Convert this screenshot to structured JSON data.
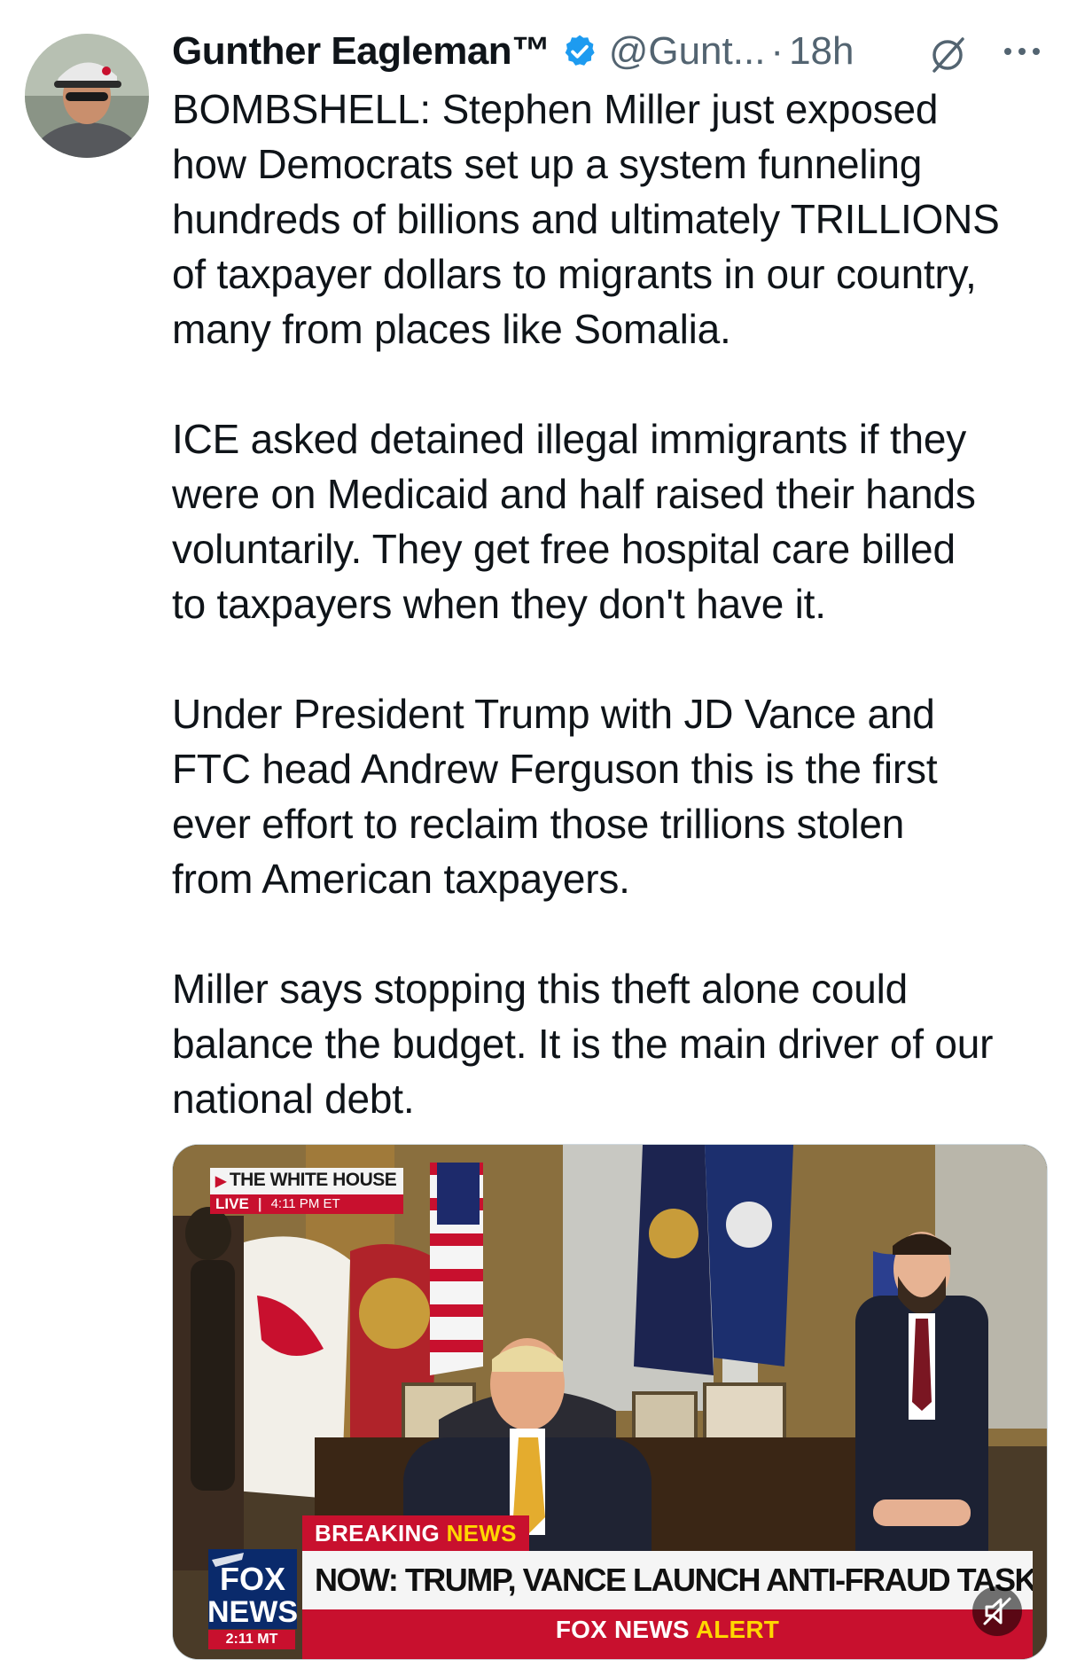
{
  "author": {
    "display_name": "Gunther Eagleman™",
    "handle": "@Gunt...",
    "dot": "·",
    "time": "18h"
  },
  "tweet": {
    "paragraphs": [
      "BOMBSHELL: Stephen Miller just exposed\nhow Democrats set up a system funneling\nhundreds of billions and ultimately TRILLIONS\nof taxpayer dollars to migrants in our country,\nmany from places like Somalia.",
      "ICE asked detained illegal immigrants if they\nwere on Medicaid and half raised their hands\nvoluntarily. They get free hospital care billed\nto taxpayers when they don't have it.",
      "Under President Trump with JD Vance and\nFTC head Andrew Ferguson this is the first\never effort to reclaim those trillions stolen\nfrom American taxpayers.",
      "Miller says stopping this theft alone could\nbalance the budget. It is the main driver of our\nnational debt."
    ]
  },
  "media": {
    "bug_title": "THE WHITE HOUSE",
    "bug_live": "LIVE",
    "bug_sep": "|",
    "bug_time": "4:11 PM ET",
    "breaking_label_1": "BREAKING",
    "breaking_label_2": "NEWS",
    "headline": "NOW: TRUMP, VANCE LAUNCH ANTI-FRAUD TASK FORCE",
    "logo_line_1": "FOX",
    "logo_line_2": "NEWS",
    "logo_time": "2:11 MT",
    "alert_1": "FOX NEWS",
    "alert_2": "ALERT"
  },
  "colors": {
    "verified": "#1d9bf0",
    "muted_text": "#536471",
    "fox_red": "#c8102e",
    "fox_yellow": "#ffd700"
  },
  "icons": [
    "verified-badge-icon",
    "grok-icon",
    "more-icon",
    "mute-icon"
  ]
}
